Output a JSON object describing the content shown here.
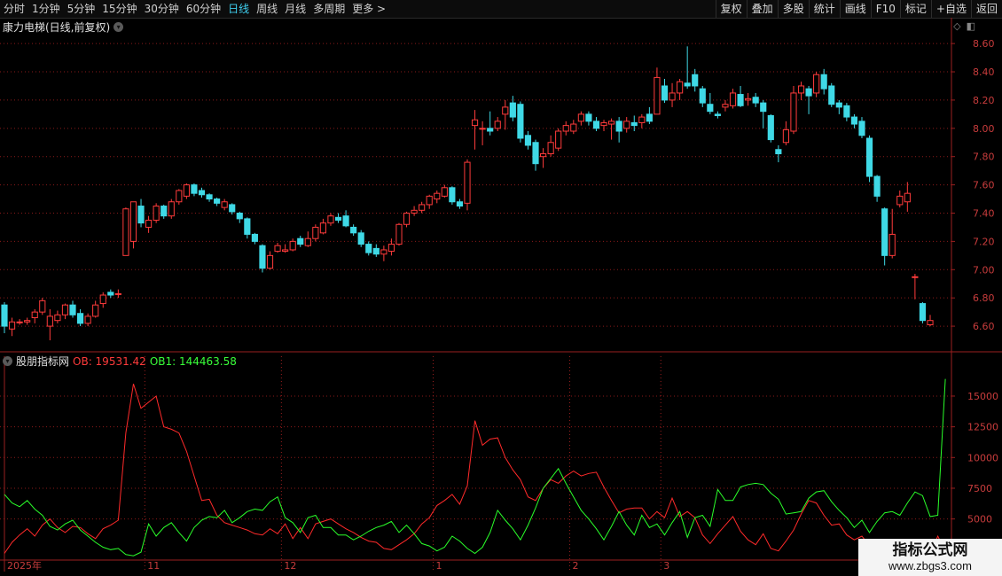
{
  "toolbar": {
    "periods": [
      "分时",
      "1分钟",
      "5分钟",
      "15分钟",
      "30分钟",
      "60分钟",
      "日线",
      "周线",
      "月线",
      "多周期",
      "更多 >"
    ],
    "active_period": "日线",
    "right_buttons": [
      "复权",
      "叠加",
      "多股",
      "统计",
      "画线",
      "F10",
      "标记",
      "+自选",
      "返回"
    ]
  },
  "main_panel": {
    "title": "康力电梯(日线,前复权)",
    "chevron_icon": "chevron-down-icon"
  },
  "indicator_panel": {
    "name": "股朋指标网",
    "ob_label": "OB: 19531.42",
    "ob1_label": "OB1: 144463.58"
  },
  "watermark": {
    "title": "指标公式网",
    "url": "www.zbgs3.com"
  },
  "colors": {
    "up": "#ff3b3b",
    "down": "#3fd9e6",
    "ob": "#ff2a2a",
    "ob1": "#2aff2a",
    "grid": "#8a1a1a"
  },
  "chart_data": [
    {
      "type": "candlestick",
      "title": "康力电梯(日线,前复权)",
      "y_ticks": [
        6.6,
        6.8,
        7.0,
        7.2,
        7.4,
        7.6,
        7.8,
        8.0,
        8.2,
        8.4,
        8.6
      ],
      "ylim": [
        6.45,
        8.72
      ],
      "x_ticks": [
        "2025年",
        "11",
        "12",
        "1",
        "2",
        "3"
      ],
      "candles": [
        [
          6.75,
          6.6,
          6.77,
          6.55
        ],
        [
          6.58,
          6.63,
          6.66,
          6.53
        ],
        [
          6.63,
          6.63,
          6.65,
          6.61
        ],
        [
          6.63,
          6.64,
          6.66,
          6.61
        ],
        [
          6.66,
          6.7,
          6.72,
          6.62
        ],
        [
          6.7,
          6.78,
          6.8,
          6.68
        ],
        [
          6.6,
          6.67,
          6.72,
          6.5
        ],
        [
          6.64,
          6.68,
          6.71,
          6.62
        ],
        [
          6.68,
          6.75,
          6.76,
          6.65
        ],
        [
          6.75,
          6.68,
          6.78,
          6.66
        ],
        [
          6.69,
          6.62,
          6.72,
          6.6
        ],
        [
          6.62,
          6.67,
          6.69,
          6.6
        ],
        [
          6.67,
          6.75,
          6.78,
          6.66
        ],
        [
          6.76,
          6.82,
          6.84,
          6.73
        ],
        [
          6.84,
          6.82,
          6.86,
          6.8
        ],
        [
          6.83,
          6.83,
          6.86,
          6.8
        ],
        [
          7.1,
          7.43,
          7.44,
          7.1
        ],
        [
          7.2,
          7.48,
          7.48,
          7.15
        ],
        [
          7.45,
          7.33,
          7.5,
          7.3
        ],
        [
          7.3,
          7.35,
          7.38,
          7.26
        ],
        [
          7.35,
          7.45,
          7.47,
          7.33
        ],
        [
          7.45,
          7.38,
          7.46,
          7.36
        ],
        [
          7.38,
          7.48,
          7.5,
          7.36
        ],
        [
          7.48,
          7.56,
          7.57,
          7.46
        ],
        [
          7.52,
          7.6,
          7.61,
          7.5
        ],
        [
          7.6,
          7.54,
          7.61,
          7.52
        ],
        [
          7.56,
          7.53,
          7.58,
          7.51
        ],
        [
          7.53,
          7.5,
          7.54,
          7.48
        ],
        [
          7.5,
          7.47,
          7.51,
          7.45
        ],
        [
          7.44,
          7.48,
          7.5,
          7.42
        ],
        [
          7.46,
          7.41,
          7.47,
          7.39
        ],
        [
          7.4,
          7.36,
          7.41,
          7.33
        ],
        [
          7.36,
          7.25,
          7.37,
          7.22
        ],
        [
          7.25,
          7.2,
          7.26,
          7.18
        ],
        [
          7.17,
          7.01,
          7.18,
          6.98
        ],
        [
          7.01,
          7.1,
          7.13,
          7.0
        ],
        [
          7.13,
          7.17,
          7.19,
          7.12
        ],
        [
          7.13,
          7.14,
          7.18,
          7.12
        ],
        [
          7.14,
          7.2,
          7.22,
          7.13
        ],
        [
          7.22,
          7.18,
          7.24,
          7.16
        ],
        [
          7.17,
          7.22,
          7.27,
          7.16
        ],
        [
          7.22,
          7.3,
          7.32,
          7.2
        ],
        [
          7.26,
          7.33,
          7.36,
          7.25
        ],
        [
          7.33,
          7.38,
          7.4,
          7.31
        ],
        [
          7.37,
          7.35,
          7.4,
          7.33
        ],
        [
          7.38,
          7.31,
          7.42,
          7.3
        ],
        [
          7.3,
          7.26,
          7.32,
          7.24
        ],
        [
          7.26,
          7.18,
          7.28,
          7.16
        ],
        [
          7.18,
          7.12,
          7.2,
          7.1
        ],
        [
          7.15,
          7.11,
          7.18,
          7.09
        ],
        [
          7.11,
          7.14,
          7.17,
          7.06
        ],
        [
          7.13,
          7.18,
          7.22,
          7.1
        ],
        [
          7.18,
          7.32,
          7.33,
          7.17
        ],
        [
          7.32,
          7.4,
          7.41,
          7.3
        ],
        [
          7.4,
          7.42,
          7.45,
          7.38
        ],
        [
          7.42,
          7.46,
          7.48,
          7.4
        ],
        [
          7.46,
          7.52,
          7.53,
          7.43
        ],
        [
          7.5,
          7.54,
          7.56,
          7.47
        ],
        [
          7.52,
          7.58,
          7.6,
          7.51
        ],
        [
          7.58,
          7.48,
          7.59,
          7.46
        ],
        [
          7.48,
          7.45,
          7.5,
          7.43
        ],
        [
          7.47,
          7.76,
          7.78,
          7.42
        ],
        [
          8.02,
          8.06,
          8.13,
          7.85
        ],
        [
          8.0,
          8.0,
          8.05,
          7.88
        ],
        [
          8.0,
          7.98,
          8.12,
          7.95
        ],
        [
          8.0,
          8.05,
          8.08,
          7.98
        ],
        [
          8.1,
          8.15,
          8.2,
          7.99
        ],
        [
          8.18,
          8.08,
          8.23,
          8.05
        ],
        [
          8.17,
          7.93,
          8.19,
          7.9
        ],
        [
          7.95,
          7.88,
          7.98,
          7.85
        ],
        [
          7.9,
          7.75,
          7.92,
          7.7
        ],
        [
          7.8,
          7.82,
          7.86,
          7.72
        ],
        [
          7.82,
          7.9,
          7.95,
          7.8
        ],
        [
          7.86,
          7.98,
          8.0,
          7.84
        ],
        [
          7.98,
          8.02,
          8.05,
          7.95
        ],
        [
          7.98,
          8.03,
          8.06,
          7.96
        ],
        [
          8.05,
          8.1,
          8.12,
          8.02
        ],
        [
          8.1,
          8.05,
          8.12,
          8.02
        ],
        [
          8.05,
          8.0,
          8.08,
          7.98
        ],
        [
          8.02,
          8.04,
          8.06,
          7.98
        ],
        [
          8.03,
          8.05,
          8.07,
          7.92
        ],
        [
          8.05,
          7.98,
          8.08,
          7.9
        ],
        [
          8.0,
          8.05,
          8.08,
          7.97
        ],
        [
          8.04,
          8.02,
          8.09,
          7.98
        ],
        [
          8.04,
          8.08,
          8.1,
          8.0
        ],
        [
          8.1,
          8.05,
          8.15,
          8.03
        ],
        [
          8.1,
          8.36,
          8.43,
          8.1
        ],
        [
          8.3,
          8.2,
          8.35,
          8.18
        ],
        [
          8.2,
          8.25,
          8.32,
          8.15
        ],
        [
          8.25,
          8.33,
          8.35,
          8.2
        ],
        [
          8.32,
          8.3,
          8.58,
          8.28
        ],
        [
          8.38,
          8.3,
          8.42,
          8.26
        ],
        [
          8.28,
          8.18,
          8.3,
          8.15
        ],
        [
          8.17,
          8.12,
          8.25,
          8.1
        ],
        [
          8.1,
          8.09,
          8.12,
          8.07
        ],
        [
          8.15,
          8.17,
          8.2,
          8.12
        ],
        [
          8.16,
          8.25,
          8.28,
          8.14
        ],
        [
          8.24,
          8.16,
          8.3,
          8.15
        ],
        [
          8.2,
          8.21,
          8.25,
          8.16
        ],
        [
          8.22,
          8.18,
          8.25,
          8.15
        ],
        [
          8.18,
          8.12,
          8.2,
          8.0
        ],
        [
          8.09,
          7.92,
          8.1,
          7.9
        ],
        [
          7.85,
          7.82,
          7.88,
          7.76
        ],
        [
          7.9,
          7.99,
          8.05,
          7.88
        ],
        [
          7.98,
          8.25,
          8.3,
          7.96
        ],
        [
          8.25,
          8.3,
          8.33,
          8.2
        ],
        [
          8.28,
          8.23,
          8.3,
          8.1
        ],
        [
          8.25,
          8.38,
          8.4,
          8.22
        ],
        [
          8.38,
          8.28,
          8.42,
          8.24
        ],
        [
          8.3,
          8.17,
          8.32,
          8.15
        ],
        [
          8.18,
          8.15,
          8.2,
          8.1
        ],
        [
          8.16,
          8.08,
          8.18,
          8.05
        ],
        [
          8.08,
          8.03,
          8.1,
          8.0
        ],
        [
          8.05,
          7.95,
          8.08,
          7.93
        ],
        [
          7.93,
          7.66,
          7.95,
          7.62
        ],
        [
          7.66,
          7.52,
          7.67,
          7.48
        ],
        [
          7.43,
          7.1,
          7.44,
          7.03
        ],
        [
          7.1,
          7.25,
          7.43,
          7.08
        ],
        [
          7.46,
          7.52,
          7.56,
          7.44
        ],
        [
          7.48,
          7.54,
          7.62,
          7.41
        ],
        [
          6.95,
          6.95,
          6.97,
          6.79
        ],
        [
          6.76,
          6.64,
          6.77,
          6.62
        ],
        [
          6.61,
          6.64,
          6.68,
          6.6
        ]
      ]
    },
    {
      "type": "line",
      "title": "股朋指标网",
      "y_ticks": [
        5000,
        7500,
        10000,
        12500,
        15000
      ],
      "ylim": [
        1800,
        18100
      ],
      "series": [
        {
          "name": "OB",
          "values": [
            2200,
            3100,
            3700,
            4200,
            3600,
            4500,
            5000,
            4300,
            3900,
            4400,
            4300,
            3800,
            3400,
            4200,
            4500,
            4900,
            12000,
            16000,
            14000,
            14500,
            15000,
            12500,
            12300,
            12000,
            10500,
            8500,
            6500,
            6600,
            5300,
            4700,
            4500,
            4300,
            4100,
            3800,
            3700,
            4200,
            3800,
            4600,
            3400,
            4300,
            3400,
            4600,
            4800,
            5000,
            4600,
            4200,
            3900,
            3500,
            3200,
            3100,
            2600,
            2500,
            2900,
            3300,
            3800,
            4600,
            5100,
            6100,
            6500,
            7000,
            6200,
            7700,
            13000,
            11000,
            11500,
            11600,
            10000,
            9000,
            8200,
            6800,
            6500,
            7500,
            8200,
            7900,
            8500,
            8900,
            8500,
            8700,
            8800,
            7600,
            6500,
            5500,
            5800,
            5900,
            5900,
            5000,
            5600,
            5100,
            6700,
            5200,
            5600,
            5100,
            3700,
            3000,
            3800,
            4500,
            5200,
            4000,
            3300,
            2900,
            3800,
            2600,
            2400,
            3200,
            4100,
            5400,
            6500,
            6300,
            5300,
            4500,
            4600,
            3700,
            3300,
            3600,
            2800,
            2100,
            3200,
            1900,
            2600,
            2000,
            3200,
            2000,
            2200,
            3600,
            2400
          ]
        },
        {
          "name": "OB1",
          "values": [
            7000,
            6300,
            6000,
            6500,
            5800,
            5300,
            4400,
            4100,
            4600,
            4900,
            4100,
            3600,
            3100,
            2700,
            2500,
            2600,
            2100,
            2000,
            2300,
            4600,
            3600,
            4300,
            4700,
            3900,
            3200,
            4300,
            4900,
            5200,
            5100,
            5700,
            4700,
            5100,
            5600,
            5800,
            5700,
            6400,
            6800,
            5100,
            4700,
            3900,
            5100,
            5300,
            4300,
            4300,
            3700,
            3700,
            3300,
            3600,
            4000,
            4300,
            4500,
            4800,
            3900,
            4500,
            3800,
            3000,
            2800,
            2400,
            2700,
            3600,
            3200,
            2600,
            2200,
            2700,
            3900,
            5700,
            4900,
            4200,
            3300,
            4500,
            5900,
            7500,
            8300,
            9100,
            7900,
            6800,
            5700,
            5000,
            4200,
            3300,
            4400,
            5600,
            4500,
            3700,
            5300,
            4300,
            4600,
            3700,
            4700,
            5600,
            3500,
            5100,
            5300,
            4400,
            7400,
            6500,
            6500,
            7600,
            7800,
            7900,
            7800,
            7100,
            6600,
            5400,
            5500,
            5600,
            6700,
            7200,
            7300,
            6400,
            5700,
            5100,
            4300,
            4900,
            3900,
            4800,
            5500,
            5600,
            5300,
            6300,
            7200,
            6900,
            5200,
            5300,
            16400
          ]
        }
      ]
    }
  ]
}
